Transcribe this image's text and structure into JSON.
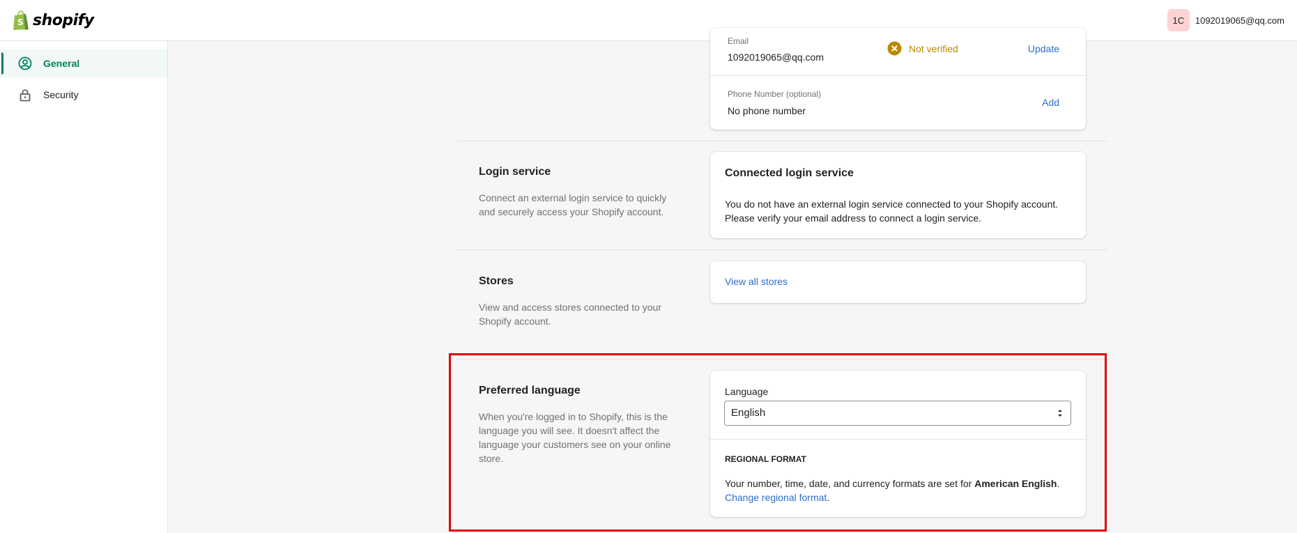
{
  "header": {
    "logo_text": "shopify",
    "avatar_initials": "1C",
    "account_email": "1092019065@qq.com"
  },
  "sidebar": {
    "items": [
      {
        "label": "General",
        "icon": "user-circle-icon",
        "active": true
      },
      {
        "label": "Security",
        "icon": "lock-icon",
        "active": false
      }
    ]
  },
  "contact_card": {
    "email_label": "Email",
    "email_value": "1092019065@qq.com",
    "email_status": "Not verified",
    "email_action": "Update",
    "phone_label": "Phone Number (optional)",
    "phone_value": "No phone number",
    "phone_action": "Add"
  },
  "login_service": {
    "title": "Login service",
    "description": "Connect an external login service to quickly and securely access your Shopify account.",
    "card_title": "Connected login service",
    "card_text_1": "You do not have an external login service connected to your Shopify account.",
    "card_text_2": "Please verify your email address to connect a login service."
  },
  "stores": {
    "title": "Stores",
    "description": "View and access stores connected to your Shopify account.",
    "link": "View all stores"
  },
  "preferred_language": {
    "title": "Preferred language",
    "description": "When you're logged in to Shopify, this is the language you will see. It doesn't affect the language your customers see on your online store.",
    "language_label": "Language",
    "language_value": "English",
    "regional_heading": "REGIONAL FORMAT",
    "regional_text": "Your number, time, date, and currency formats are set for ",
    "regional_locale": "American English",
    "period": ".",
    "regional_link": "Change regional format"
  },
  "colors": {
    "accent": "#008060",
    "link": "#2c6ecb",
    "warning": "#b98900",
    "highlight": "#e10000"
  }
}
